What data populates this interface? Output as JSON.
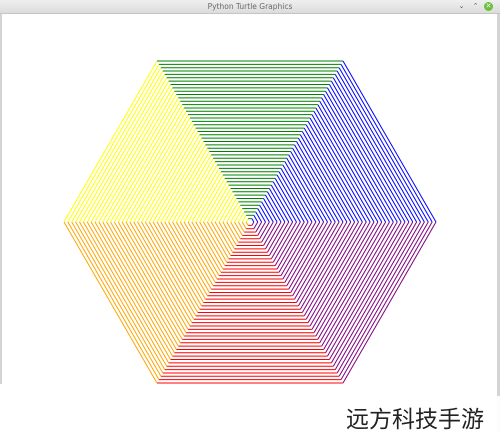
{
  "window": {
    "title": "Python Turtle Graphics",
    "controls": {
      "minimize": "⌄",
      "maximize": "⌃",
      "close": "✕"
    }
  },
  "drawing": {
    "shape": "hexagon",
    "segments": [
      {
        "name": "top-left",
        "color": "#ffff00"
      },
      {
        "name": "top",
        "color": "#008000"
      },
      {
        "name": "top-right",
        "color": "#0000ff"
      },
      {
        "name": "bottom-right",
        "color": "#800080"
      },
      {
        "name": "bottom",
        "color": "#ff0000"
      },
      {
        "name": "bottom-left",
        "color": "#ffa500"
      }
    ]
  },
  "watermark": {
    "text": "远方科技手游"
  }
}
